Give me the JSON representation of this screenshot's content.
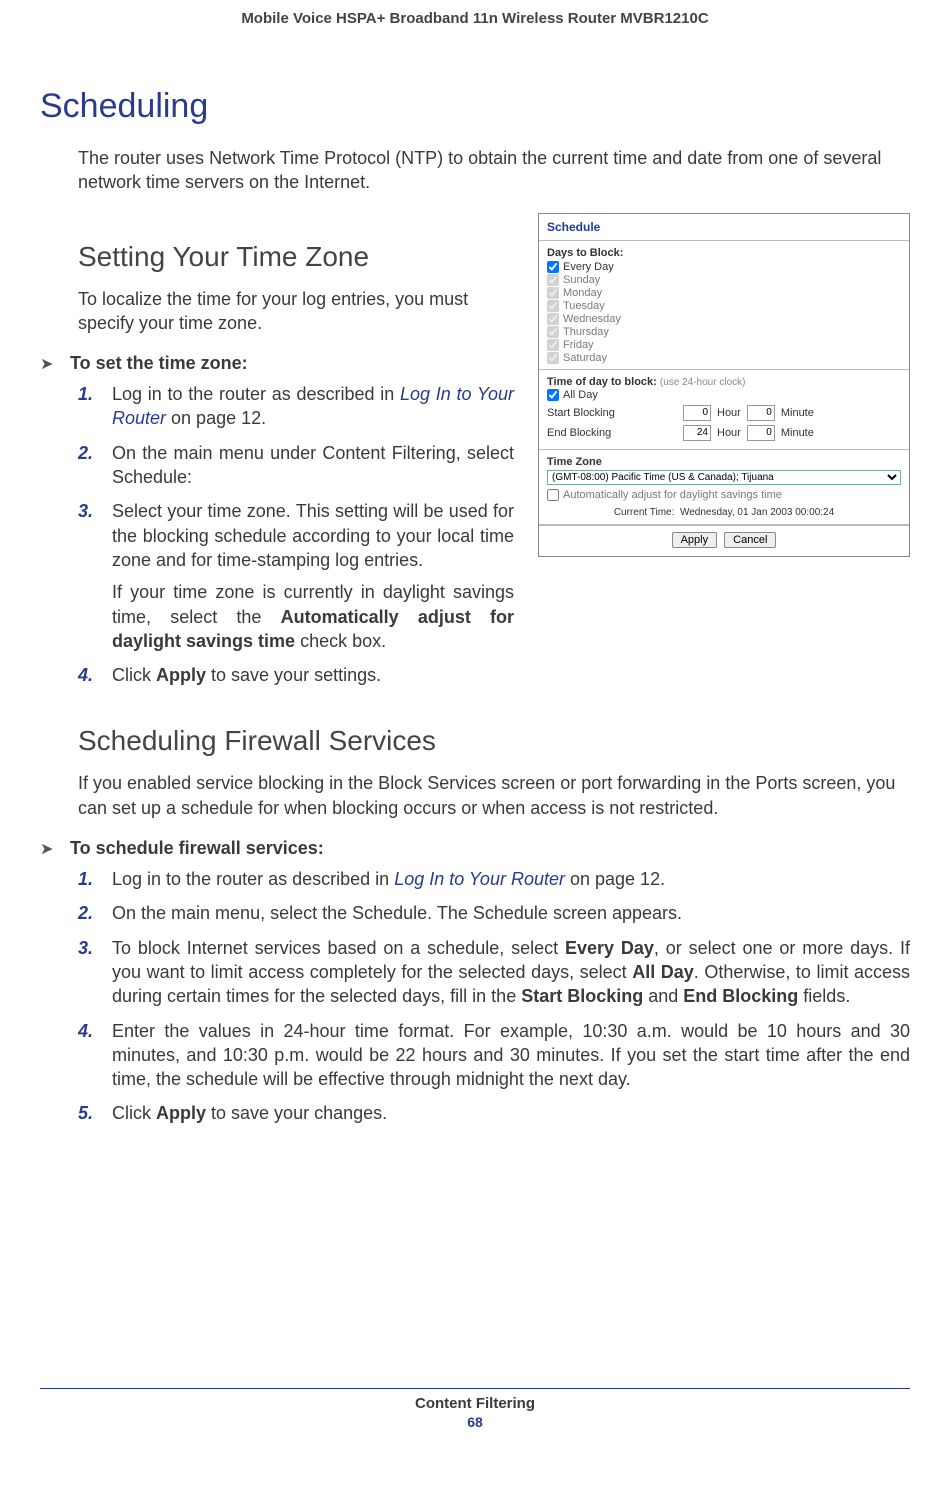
{
  "running_head": "Mobile Voice HSPA+ Broadband 11n Wireless Router MVBR1210C",
  "h1": "Scheduling",
  "intro": "The router uses Network Time Protocol (NTP) to obtain the current time and date from one of several network time servers on the Internet.",
  "tz": {
    "title": "Setting Your Time Zone",
    "lead": "To localize the time for your log entries, you must specify your time zone.",
    "proc_title": "To set the time zone:",
    "s1_a": "Log in to the router as described in ",
    "s1_link": "Log In to Your Router",
    "s1_b": " on page 12.",
    "s2": "On the main menu under Content Filtering, select Schedule:",
    "s3_a": "Select your time zone. This setting will be used for the blocking schedule according to your local time zone and for time-stamping log entries.",
    "s3_b_a": "If your time zone is currently in daylight savings time, select the ",
    "s3_b_bold": "Automatically adjust for daylight savings time",
    "s3_b_b": " check box.",
    "s4_a": "Click ",
    "s4_bold": "Apply",
    "s4_b": " to save your settings."
  },
  "fw": {
    "title": "Scheduling Firewall Services",
    "lead": "If you enabled service blocking in the Block Services screen or port forwarding in the Ports screen, you can set up a schedule for when blocking occurs or when access is not restricted.",
    "proc_title": "To schedule firewall services:",
    "s1_a": "Log in to the router as described in ",
    "s1_link": "Log In to Your Router",
    "s1_b": " on page 12.",
    "s2": "On the main menu, select the Schedule. The Schedule screen appears.",
    "s3_a": "To block Internet services based on a schedule, select ",
    "s3_b1": "Every Day",
    "s3_c": ", or select one or more days. If you want to limit access completely for the selected days, select ",
    "s3_b2": "All Day",
    "s3_d": ". Otherwise, to limit access during certain times for the selected days, fill in the ",
    "s3_b3": "Start Blocking",
    "s3_e": " and ",
    "s3_b4": "End Blocking",
    "s3_f": " fields.",
    "s4": "Enter the values in 24-hour time format. For example, 10:30 a.m. would be 10 hours and 30 minutes, and 10:30 p.m. would be 22 hours and 30 minutes. If you set the start time after the end time, the schedule will be effective through midnight the next day.",
    "s5_a": "Click ",
    "s5_bold": "Apply",
    "s5_b": " to save your changes."
  },
  "shot": {
    "title": "Schedule",
    "days_label": "Days to Block:",
    "days": [
      "Every Day",
      "Sunday",
      "Monday",
      "Tuesday",
      "Wednesday",
      "Thursday",
      "Friday",
      "Saturday"
    ],
    "tod_label": "Time of day to block:",
    "tod_hint": "(use 24-hour clock)",
    "all_day": "All Day",
    "start": "Start Blocking",
    "end": "End Blocking",
    "hour": "Hour",
    "minute": "Minute",
    "start_h": "0",
    "start_m": "0",
    "end_h": "24",
    "end_m": "0",
    "tz_label": "Time Zone",
    "tz_option": "(GMT-08:00) Pacific Time (US & Canada); Tijuana",
    "dst": "Automatically adjust for daylight savings time",
    "curtime": "Current Time:  Wednesday, 01 Jan 2003 00:00:24",
    "apply": "Apply",
    "cancel": "Cancel"
  },
  "footer": {
    "section": "Content Filtering",
    "page": "68"
  },
  "nums": {
    "n1": "1.",
    "n2": "2.",
    "n3": "3.",
    "n4": "4.",
    "n5": "5."
  },
  "arrow": "➤"
}
